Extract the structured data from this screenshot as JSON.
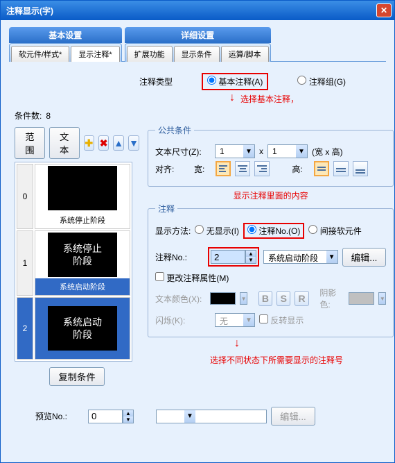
{
  "title": "注释显示(字)",
  "main_tabs": {
    "basic": {
      "title": "基本设置",
      "subs": [
        "软元件/样式*",
        "显示注释*"
      ]
    },
    "detail": {
      "title": "详细设置",
      "subs": [
        "扩展功能",
        "显示条件",
        "运算/脚本"
      ]
    }
  },
  "annotation_type": {
    "label": "注释类型",
    "basic": "基本注释(A)",
    "group": "注释组(G)"
  },
  "notes": {
    "select_basic": "选择基本注释，",
    "show_content": "显示注释里面的内容",
    "select_num": "选择不同状态下所需要显示的注释号"
  },
  "condition_count": {
    "label": "条件数:",
    "value": "8"
  },
  "range_btn": "范围",
  "text_btn": "文本",
  "copy_btn": "复制条件",
  "thumbs": [
    {
      "idx": "0",
      "label": "系统停止阶段",
      "inner": ""
    },
    {
      "idx": "1",
      "label": "系统启动阶段",
      "inner": "系统停止\n阶段",
      "selected": true
    },
    {
      "idx": "2",
      "label": "",
      "inner": "系统启动\n阶段",
      "rowsel": true
    }
  ],
  "common": {
    "legend": "公共条件",
    "textsize": "文本尺寸(Z):",
    "w": "1",
    "h": "1",
    "wxh": "(宽 x 高)",
    "align": "对齐:",
    "width_label": "宽:",
    "height_label": "高:"
  },
  "anno": {
    "legend": "注释",
    "display_method": "显示方法:",
    "none": "无显示(I)",
    "by_no": "注释No.(O)",
    "indirect": "间接软元件",
    "no_label": "注释No.:",
    "no_val": "2",
    "combo_val": "系统启动阶段",
    "edit": "编辑...",
    "change_prop": "更改注释属性(M)",
    "textcolor": "文本颜色(X):",
    "shadow": "阴影色:",
    "blink": "闪烁(K):",
    "blink_val": "无",
    "reverse": "反转显示",
    "bsr": [
      "B",
      "S",
      "R"
    ]
  },
  "preview": {
    "label": "预览No.:",
    "val": "0",
    "edit": "编辑..."
  }
}
